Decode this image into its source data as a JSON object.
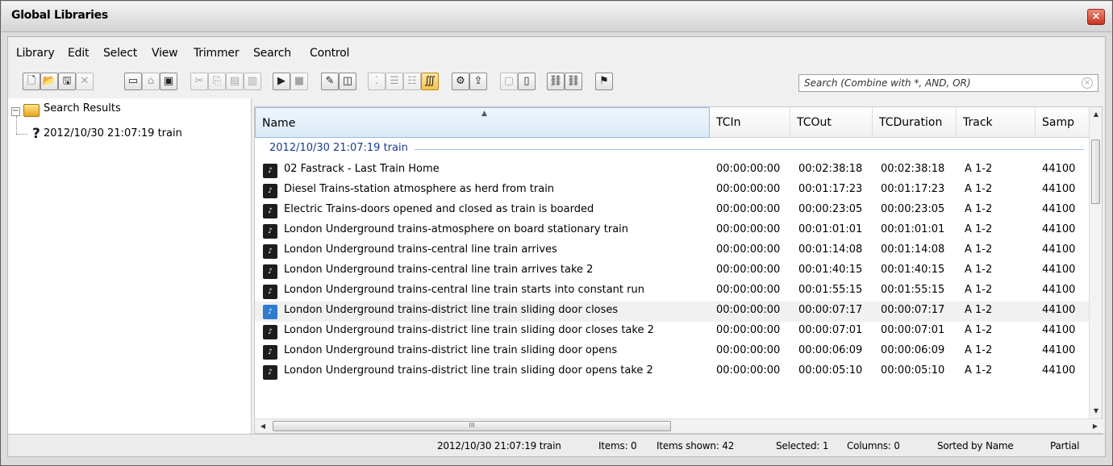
{
  "window": {
    "title": "Global Libraries",
    "close_label": "×"
  },
  "menu": [
    "Library",
    "Edit",
    "Select",
    "View",
    "Trimmer",
    "Search",
    "Control"
  ],
  "toolbar": {
    "buttons": [
      {
        "name": "new-icon",
        "glyph": "🗋"
      },
      {
        "name": "open-icon",
        "glyph": "📂"
      },
      {
        "name": "save-icon",
        "glyph": "🖫"
      },
      {
        "name": "delete-icon",
        "glyph": "✕"
      },
      {
        "name": "new-folder-icon",
        "glyph": "▭"
      },
      {
        "name": "open-folder-icon",
        "glyph": "⌂"
      },
      {
        "name": "library-icon",
        "glyph": "▣"
      },
      {
        "name": "cut-icon",
        "glyph": "✂"
      },
      {
        "name": "copy-icon",
        "glyph": "⎘"
      },
      {
        "name": "paste-icon",
        "glyph": "▤"
      },
      {
        "name": "paste-special-icon",
        "glyph": "▥"
      },
      {
        "name": "play-icon",
        "glyph": "▶"
      },
      {
        "name": "stop-icon",
        "glyph": "■"
      },
      {
        "name": "properties-icon",
        "glyph": "✎"
      },
      {
        "name": "duplicate-icon",
        "glyph": "◫"
      },
      {
        "name": "small-icons-icon",
        "glyph": "⁚"
      },
      {
        "name": "list-icon",
        "glyph": "☰"
      },
      {
        "name": "details-icon",
        "glyph": "☷"
      },
      {
        "name": "columns-icon",
        "glyph": "∭"
      },
      {
        "name": "settings-icon",
        "glyph": "⚙"
      },
      {
        "name": "export-icon",
        "glyph": "⇪"
      },
      {
        "name": "window-icon",
        "glyph": "▢"
      },
      {
        "name": "page-icon",
        "glyph": "▯"
      },
      {
        "name": "link-icon",
        "glyph": "⛓"
      },
      {
        "name": "unlink-icon",
        "glyph": "⛓"
      },
      {
        "name": "bookmark-icon",
        "glyph": "⚑"
      }
    ],
    "search_placeholder": "Search  (Combine with *, AND, OR)"
  },
  "tree": {
    "root": "Search Results",
    "child": "2012/10/30 21:07:19 train",
    "expander": "−",
    "child_icon": "?"
  },
  "table": {
    "columns": [
      "Name",
      "TCIn",
      "TCOut",
      "TCDuration",
      "Track",
      "Samp"
    ],
    "group": "2012/10/30 21:07:19 train",
    "rows": [
      [
        "02 Fastrack - Last Train Home",
        "00:00:00:00",
        "00:02:38:18",
        "00:02:38:18",
        "A 1-2",
        "44100"
      ],
      [
        "Diesel Trains-station atmosphere as herd from train",
        "00:00:00:00",
        "00:01:17:23",
        "00:01:17:23",
        "A 1-2",
        "44100"
      ],
      [
        "Electric Trains-doors opened and closed as train is boarded",
        "00:00:00:00",
        "00:00:23:05",
        "00:00:23:05",
        "A 1-2",
        "44100"
      ],
      [
        "London Underground trains-atmosphere on board stationary train",
        "00:00:00:00",
        "00:01:01:01",
        "00:01:01:01",
        "A 1-2",
        "44100"
      ],
      [
        "London Underground trains-central line train arrives",
        "00:00:00:00",
        "00:01:14:08",
        "00:01:14:08",
        "A 1-2",
        "44100"
      ],
      [
        "London Underground trains-central line train arrives take 2",
        "00:00:00:00",
        "00:01:40:15",
        "00:01:40:15",
        "A 1-2",
        "44100"
      ],
      [
        "London Underground trains-central line train starts into constant run",
        "00:00:00:00",
        "00:01:55:15",
        "00:01:55:15",
        "A 1-2",
        "44100"
      ],
      [
        "London Underground trains-district line train sliding door closes",
        "00:00:00:00",
        "00:00:07:17",
        "00:00:07:17",
        "A 1-2",
        "44100"
      ],
      [
        "London Underground trains-district line train sliding door closes take 2",
        "00:00:00:00",
        "00:00:07:01",
        "00:00:07:01",
        "A 1-2",
        "44100"
      ],
      [
        "London Underground trains-district line train sliding door opens",
        "00:00:00:00",
        "00:00:06:09",
        "00:00:06:09",
        "A 1-2",
        "44100"
      ],
      [
        "London Underground trains-district line train sliding door opens take 2",
        "00:00:00:00",
        "00:00:05:10",
        "00:00:05:10",
        "A 1-2",
        "44100"
      ]
    ]
  },
  "status": {
    "list": "2012/10/30 21:07:19 train",
    "items": "Items: 0",
    "shown": "Items shown: 42",
    "selected": "Selected: 1",
    "columns": "Columns: 0",
    "sorted": "Sorted by Name",
    "mode": "Partial"
  },
  "scroll_labels": {
    "up": "▲",
    "down": "▼",
    "left": "◀",
    "right": "▶",
    "grip": "III"
  }
}
